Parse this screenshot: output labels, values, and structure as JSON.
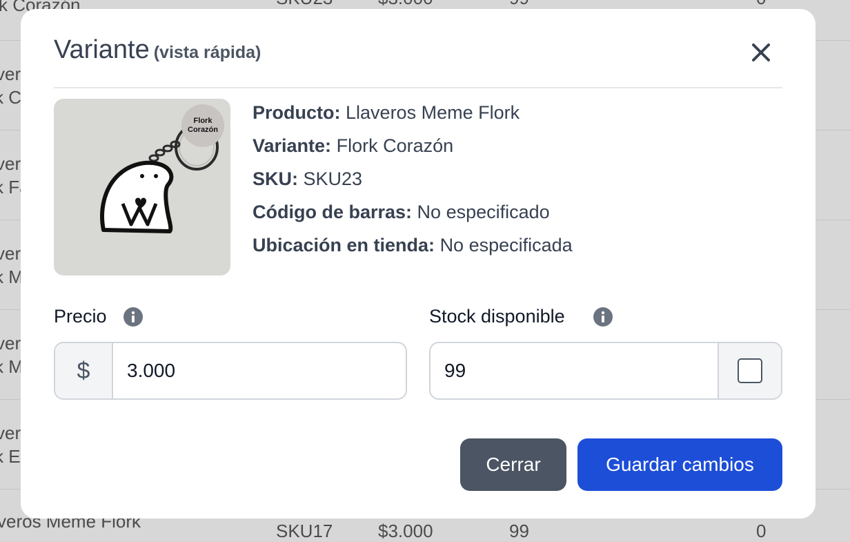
{
  "background_table": {
    "rows": [
      {
        "name": "k Corazón",
        "sku": "SKU23",
        "price": "$3.000",
        "stock": "99",
        "extra": "0"
      },
      {
        "name": "ver",
        "sub": "k C"
      },
      {
        "name": "ver",
        "sub": "k Fa"
      },
      {
        "name": "ver",
        "sub": "k M"
      },
      {
        "name": "ver",
        "sub": "k M"
      },
      {
        "name": "ver",
        "sub": "k Er"
      },
      {
        "name": "veros Meme Flork",
        "sku": "SKU17",
        "price": "$3.000",
        "stock": "99",
        "extra": "0"
      }
    ]
  },
  "modal": {
    "title": "Variante",
    "subtitle": "(vista rápida)",
    "close_icon": "close-x-icon",
    "thumbnail": {
      "badge_line1": "Flork",
      "badge_line2": "Corazón"
    },
    "details": {
      "product_label": "Producto:",
      "product_value": "Llaveros Meme Flork",
      "variant_label": "Variante:",
      "variant_value": "Flork Corazón",
      "sku_label": "SKU:",
      "sku_value": "SKU23",
      "barcode_label": "Código de barras:",
      "barcode_value": "No especificado",
      "location_label": "Ubicación en tienda:",
      "location_value": "No especificada"
    },
    "price": {
      "label": "Precio",
      "currency": "$",
      "value": "3.000",
      "info_icon": "info-icon"
    },
    "stock": {
      "label": "Stock disponible",
      "value": "99",
      "info_icon": "info-icon",
      "checkbox_checked": false
    },
    "buttons": {
      "close_label": "Cerrar",
      "save_label": "Guardar cambios"
    }
  },
  "colors": {
    "primary": "#1d4ed8",
    "secondary": "#4b5563",
    "overlay": "#d7d7d7"
  }
}
